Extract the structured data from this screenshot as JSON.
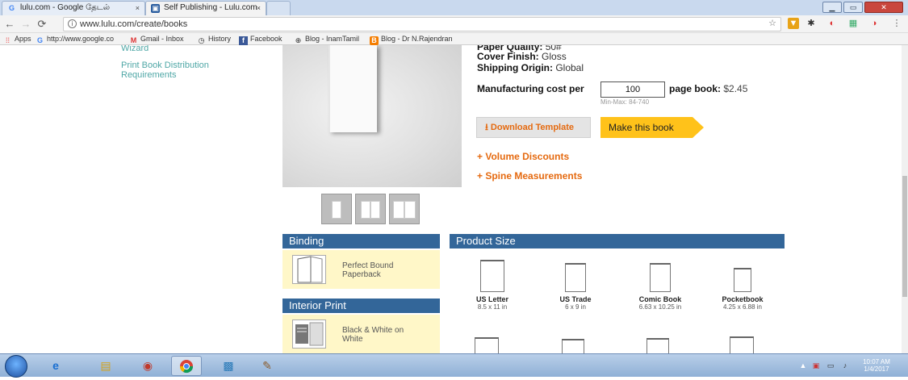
{
  "browser": {
    "tabs": [
      {
        "label": "lulu.com - Google தேடல்",
        "icon": "google-icon"
      },
      {
        "label": "Self Publishing - Lulu.com",
        "icon": "lulu-icon"
      }
    ],
    "tab_close": "×",
    "url": "www.lulu.com/create/books",
    "info_glyph": "i",
    "bookmarks": [
      {
        "label": "Apps",
        "icon": "apps-grid-icon"
      },
      {
        "label": "http://www.google.co",
        "icon": "google-icon"
      },
      {
        "label": "Gmail - Inbox",
        "icon": "gmail-icon"
      },
      {
        "label": "History",
        "icon": "history-icon"
      },
      {
        "label": "Facebook",
        "icon": "facebook-icon"
      },
      {
        "label": "Blog - InamTamil",
        "icon": "blog-icon"
      },
      {
        "label": "Blog - Dr N.Rajendran",
        "icon": "blogger-icon"
      }
    ]
  },
  "sidebar": {
    "link_wizard": "Wizard",
    "link_distribution": "Print Book Distribution Requirements"
  },
  "specs": {
    "paper_quality_label": "Paper Quality:",
    "paper_quality_value": "50#",
    "cover_finish_label": "Cover Finish:",
    "cover_finish_value": "Gloss",
    "shipping_label": "Shipping Origin:",
    "shipping_value": "Global",
    "cost_prefix": "Manufacturing cost per",
    "page_count": "100",
    "cost_suffix": "page book:",
    "cost_value": "$2.45",
    "minmax": "Min-Max: 84-740"
  },
  "actions": {
    "download_template": "Download Template",
    "make_book": "Make this book",
    "volume_discounts": "+ Volume Discounts",
    "spine_measurements": "+ Spine Measurements"
  },
  "binding": {
    "heading": "Binding",
    "option": "Perfect Bound Paperback"
  },
  "interior": {
    "heading": "Interior Print",
    "option": "Black & White on White"
  },
  "product_size": {
    "heading": "Product Size",
    "sizes": [
      {
        "name": "US Letter",
        "dim": "8.5 x 11 in"
      },
      {
        "name": "US Trade",
        "dim": "6 x 9 in"
      },
      {
        "name": "Comic Book",
        "dim": "6.63 x 10.25 in"
      },
      {
        "name": "Pocketbook",
        "dim": "4.25 x 6.88 in"
      }
    ]
  },
  "taskbar": {
    "time": "10:07 AM",
    "date": "1/4/2017"
  },
  "colors": {
    "panel_header": "#336699",
    "panel_body": "#fff7c8",
    "accent_orange": "#e56a10",
    "make_book_yellow": "#ffc21a",
    "link_teal": "#4fa7a6"
  }
}
